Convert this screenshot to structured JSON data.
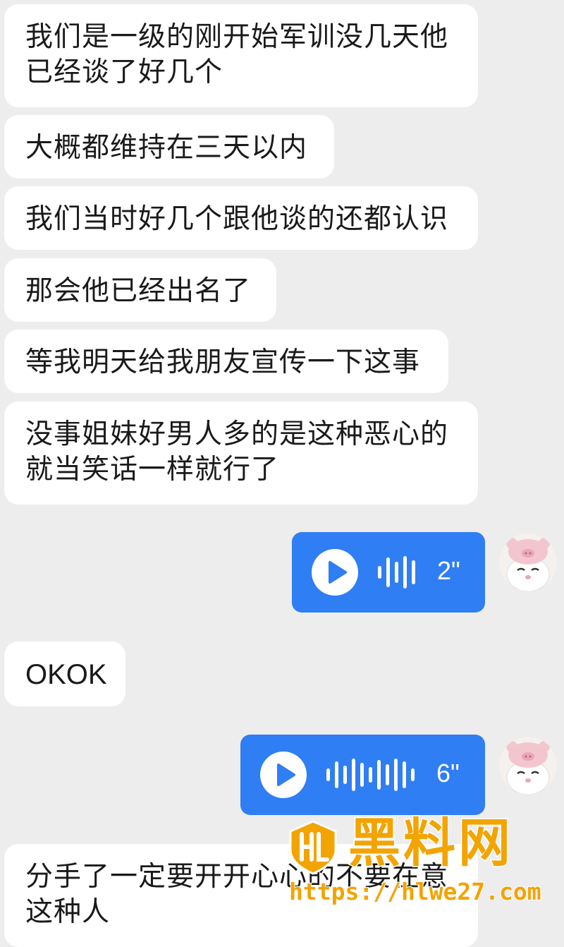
{
  "messages": [
    {
      "side": "incoming",
      "type": "text",
      "text": "我们是一级的刚开始军训没几天他\n已经谈了好几个"
    },
    {
      "side": "incoming",
      "type": "text",
      "text": "大概都维持在三天以内"
    },
    {
      "side": "incoming",
      "type": "text",
      "text": "我们当时好几个跟他谈的还都认识"
    },
    {
      "side": "incoming",
      "type": "text",
      "text": "那会他已经出名了"
    },
    {
      "side": "incoming",
      "type": "text",
      "text": "等我明天给我朋友宣传一下这事"
    },
    {
      "side": "incoming",
      "type": "text",
      "text": "没事姐妹好男人多的是这种恶心的\n就当笑话一样就行了"
    },
    {
      "side": "outgoing",
      "type": "voice",
      "duration": "2\"",
      "avatar_icon": "bunny-pig-hat-avatar-icon"
    },
    {
      "side": "incoming",
      "type": "text",
      "text": "OKOK"
    },
    {
      "side": "outgoing",
      "type": "voice",
      "duration": "6\"",
      "avatar_icon": "bunny-pig-hat-avatar-icon"
    },
    {
      "side": "incoming",
      "type": "text",
      "text": "分手了一定要开开心心的不要在意\n这种人"
    }
  ],
  "watermark": {
    "title": "黑料网",
    "url": "https://hlwe27.com",
    "logo_icon": "hl-shield-logo-icon"
  },
  "colors": {
    "background": "#ededed",
    "incoming_bubble": "#ffffff",
    "voice_bubble": "#2f7ef3",
    "watermark": "#f2a400"
  }
}
